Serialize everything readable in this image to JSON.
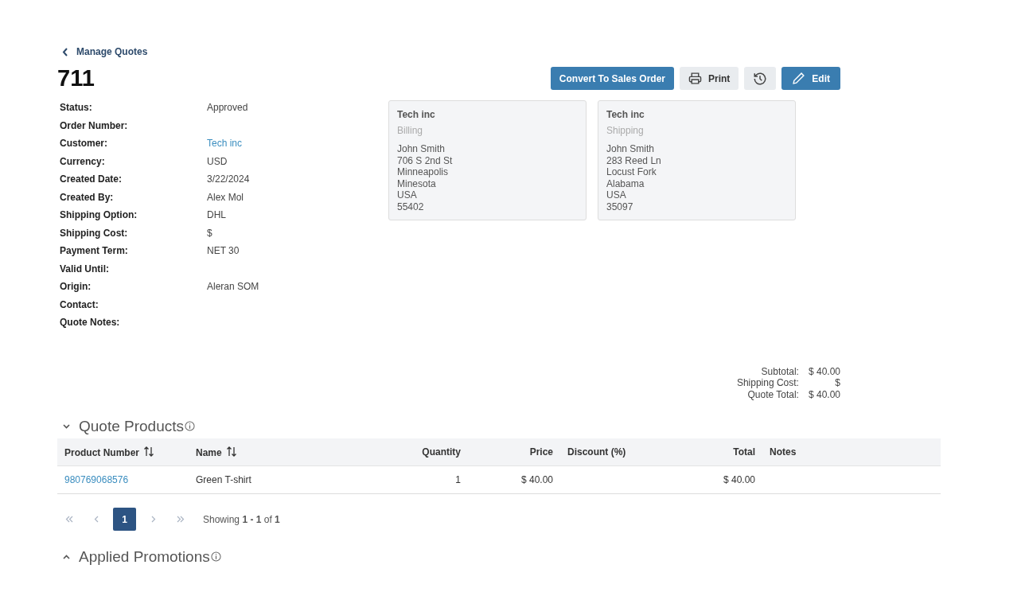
{
  "back_link": {
    "label": "Manage Quotes"
  },
  "title": "711",
  "toolbar": {
    "convert_button": {
      "label": "Convert To Sales Order"
    },
    "print_button": {
      "label": "Print"
    },
    "edit_button": {
      "label": "Edit"
    }
  },
  "details": [
    {
      "label": "Status:",
      "value": "Approved",
      "kind": "text"
    },
    {
      "label": "Order Number:"
    },
    {
      "label": "Customer:",
      "value": "Tech inc",
      "kind": "link"
    },
    {
      "label": "Currency:",
      "value": "USD",
      "kind": "text"
    },
    {
      "label": "Created Date:",
      "value": "3/22/2024",
      "kind": "text"
    },
    {
      "label": "Created By:",
      "value": "Alex Mol",
      "kind": "text"
    },
    {
      "label": "Shipping Option:",
      "value": "DHL",
      "kind": "text"
    },
    {
      "label": "Shipping Cost:",
      "value": "$",
      "kind": "text"
    },
    {
      "label": "Payment Term:",
      "value": "NET 30",
      "kind": "text"
    },
    {
      "label": "Valid Until:"
    },
    {
      "label": "Origin:",
      "value": "Aleran SOM",
      "kind": "text"
    },
    {
      "label": "Contact:"
    },
    {
      "label": "Quote Notes:"
    }
  ],
  "addresses": [
    {
      "company": "Tech inc",
      "type": "Billing",
      "lines": [
        "John Smith",
        "706 S 2nd St",
        "Minneapolis",
        "Minesota",
        "USA",
        "55402"
      ]
    },
    {
      "company": "Tech inc",
      "type": "Shipping",
      "lines": [
        "John Smith",
        "283 Reed Ln",
        "Locust Fork",
        "Alabama",
        "USA",
        "35097"
      ]
    }
  ],
  "totals": [
    {
      "label": "Subtotal:",
      "value": "$ 40.00"
    },
    {
      "label": "Shipping Cost:",
      "value": "$"
    },
    {
      "label": "Quote Total:",
      "value": "$ 40.00"
    }
  ],
  "quote_products": {
    "title": "Quote Products",
    "expanded": true,
    "table": {
      "columns": [
        {
          "label": "Product Number",
          "sortable": true
        },
        {
          "label": "Name",
          "sortable": true
        },
        {
          "label": "Quantity",
          "sortable": false
        },
        {
          "label": "Price",
          "sortable": false
        },
        {
          "label": "Discount (%)",
          "sortable": false
        },
        {
          "label": "Total",
          "sortable": false
        },
        {
          "label": "Notes",
          "sortable": false
        }
      ],
      "rows": [
        [
          {
            "text": "980769068576",
            "kind": "link"
          },
          {
            "text": "Green T-shirt",
            "kind": "text"
          },
          {
            "text": "1",
            "kind": "text"
          },
          {
            "text": "$ 40.00",
            "kind": "text"
          },
          null,
          {
            "text": "$ 40.00",
            "kind": "text"
          },
          null
        ]
      ]
    },
    "pagination": {
      "pages": [
        {
          "label": "1",
          "selected": true
        }
      ],
      "summary": "Showing **1 - 1** of **1**"
    }
  },
  "applied_promotions": {
    "title": "Applied Promotions",
    "expanded": false
  }
}
